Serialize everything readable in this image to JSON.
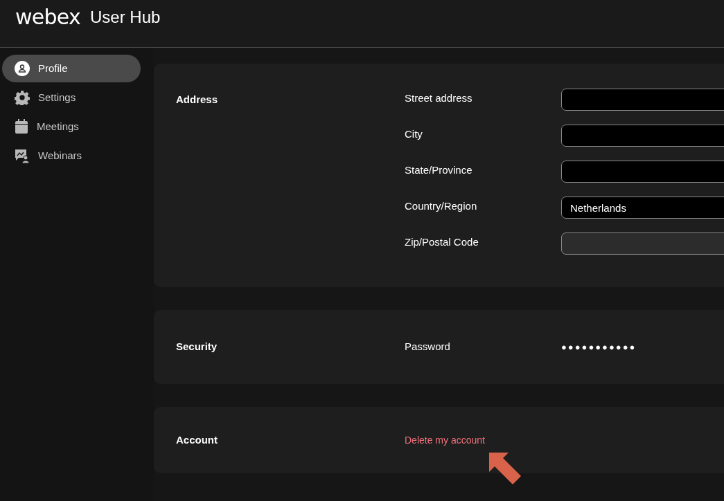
{
  "header": {
    "logo": "webex",
    "title": "User Hub"
  },
  "sidebar": {
    "items": [
      {
        "label": "Profile",
        "selected": true
      },
      {
        "label": "Settings",
        "selected": false
      },
      {
        "label": "Meetings",
        "selected": false
      },
      {
        "label": "Webinars",
        "selected": false
      }
    ]
  },
  "sections": [
    {
      "title": "Address",
      "kind": "fields",
      "fields": [
        {
          "label": "Street address",
          "disabled": false
        },
        {
          "label": "City",
          "disabled": false
        },
        {
          "label": "State/Province",
          "disabled": false
        },
        {
          "label": "Country/Region",
          "value": "Netherlands",
          "disabled": false
        },
        {
          "label": "Zip/Postal Code",
          "disabled": true
        }
      ]
    },
    {
      "title": "Security",
      "kind": "password",
      "label": "Password",
      "value": "●●●●●●●●●●●"
    },
    {
      "title": "Account",
      "kind": "link",
      "link": "Delete my account"
    }
  ]
}
